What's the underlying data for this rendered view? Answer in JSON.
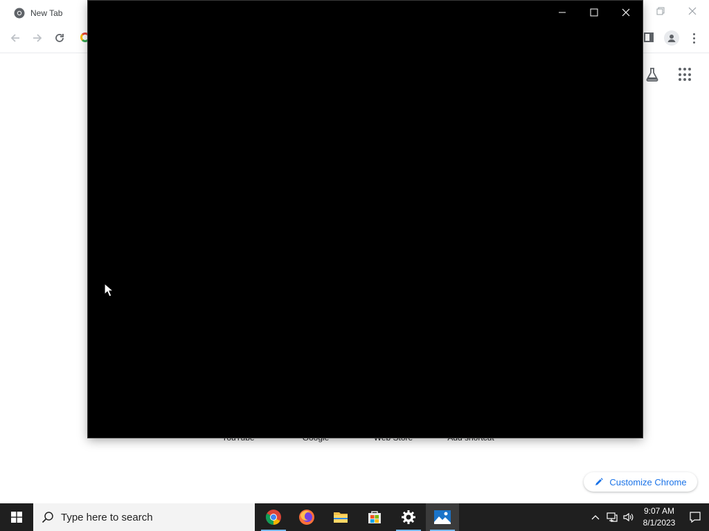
{
  "browser": {
    "tab_title": "New Tab",
    "shortcuts": [
      "YouTube",
      "Google",
      "Web Store",
      "Add shortcut"
    ],
    "customize_label": "Customize Chrome"
  },
  "taskbar": {
    "search_placeholder": "Type here to search",
    "apps": [
      "chrome-icon",
      "firefox-icon",
      "file-explorer-icon",
      "microsoft-store-icon",
      "settings-icon",
      "photos-icon"
    ],
    "time": "9:07 AM",
    "date": "8/1/2023"
  },
  "colors": {
    "accent": "#1a73e8",
    "taskbar_bg": "#1f1f1f",
    "app_window_bg": "#000000",
    "active_underline": "#76b9ed"
  }
}
